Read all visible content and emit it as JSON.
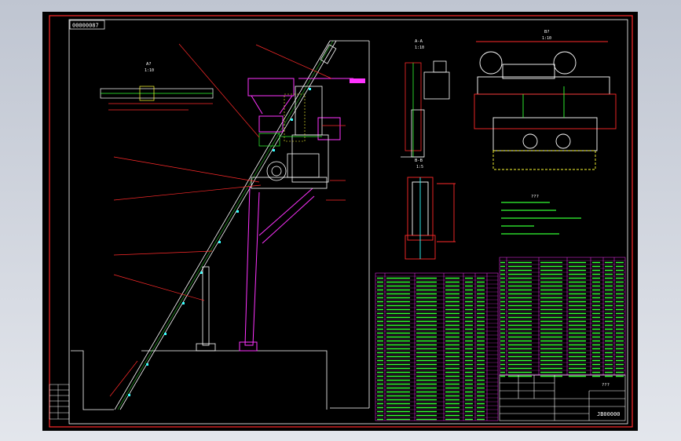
{
  "drawing": {
    "code_top": "00000087",
    "code_bottom": "JB00000",
    "view_a_label": "A-A",
    "view_a_scale": "1:10",
    "view_aq_label": "A?",
    "view_aq_scale": "1:10",
    "view_b_label": "B-B",
    "view_b_scale": "1:5",
    "view_bq_label": "B?",
    "view_bq_scale": "1:10",
    "notes_title": "???",
    "title_box": "???"
  },
  "colors": {
    "background": "#000000",
    "frame": "#ff2a2a",
    "outline": "#ffffff",
    "magenta": "#ff33ff",
    "yellow": "#ffff33",
    "green": "#33ff33",
    "cyan": "#33ffff"
  }
}
